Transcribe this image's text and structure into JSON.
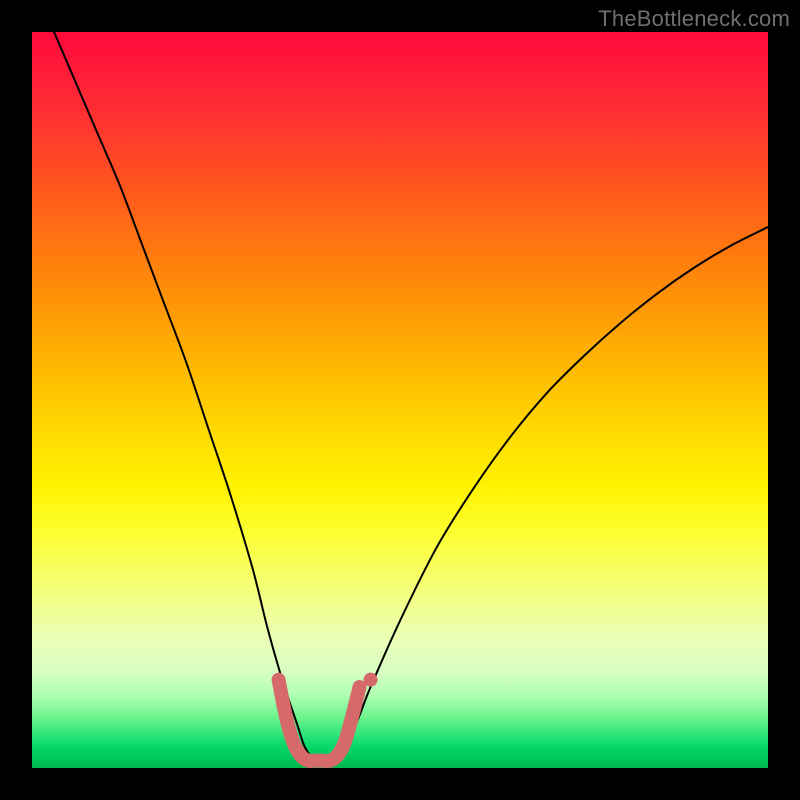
{
  "watermark": "TheBottleneck.com",
  "chart_data": {
    "type": "line",
    "title": "",
    "xlabel": "",
    "ylabel": "",
    "xlim": [
      0,
      100
    ],
    "ylim": [
      0,
      100
    ],
    "grid": false,
    "legend": false,
    "series": [
      {
        "name": "bottleneck-curve",
        "color": "#000000",
        "x": [
          3,
          6,
          9,
          12,
          15,
          18,
          21,
          24,
          27,
          30,
          32,
          34,
          36,
          37,
          38,
          39,
          40,
          42,
          44,
          46,
          50,
          55,
          60,
          65,
          70,
          75,
          80,
          85,
          90,
          95,
          100
        ],
        "values": [
          100,
          93,
          86,
          79,
          71,
          63,
          55,
          46,
          37,
          27,
          19,
          12,
          6,
          3,
          1.5,
          1,
          1.5,
          3,
          6,
          11,
          20,
          30,
          38,
          45,
          51,
          56,
          60.5,
          64.5,
          68,
          71,
          73.5
        ]
      },
      {
        "name": "min-band-marker",
        "color": "#d66a6a",
        "x": [
          33.5,
          34.5,
          35.5,
          36.5,
          37.5,
          38.5,
          39.5,
          40.5,
          41.5,
          42.5,
          43.5,
          44.5
        ],
        "values": [
          12,
          7,
          3.5,
          1.7,
          1,
          1,
          1,
          1,
          1.7,
          3.5,
          7,
          11
        ]
      }
    ],
    "points": [
      {
        "name": "marker-dot",
        "x": 46,
        "y": 12,
        "color": "#d66a6a"
      }
    ]
  }
}
